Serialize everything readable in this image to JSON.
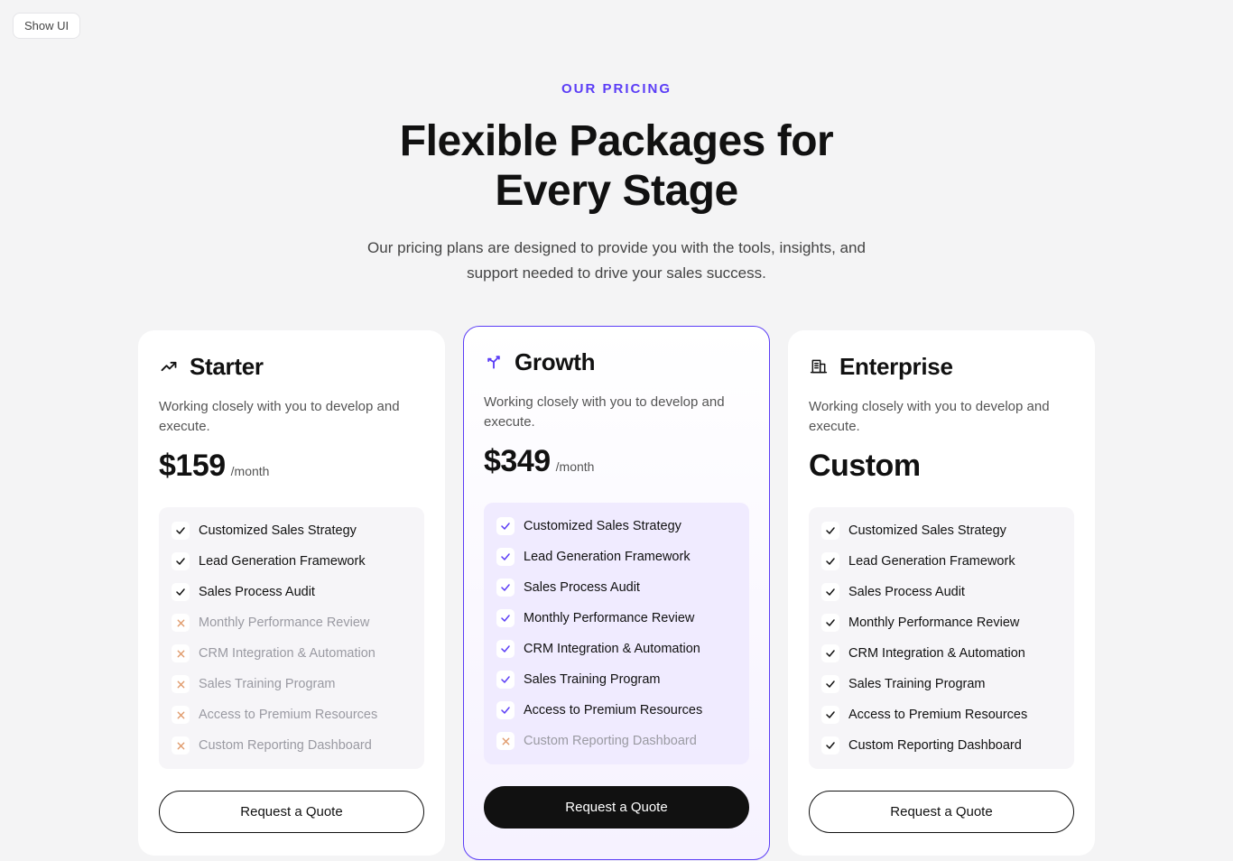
{
  "show_ui_label": "Show UI",
  "eyebrow": "OUR PRICING",
  "headline_line1": "Flexible Packages for",
  "headline_line2": "Every Stage",
  "subhead": "Our pricing plans are designed to provide you with the tools, insights, and support needed to drive your sales success.",
  "feature_names": [
    "Customized Sales Strategy",
    "Lead Generation Framework",
    "Sales Process Audit",
    "Monthly Performance Review",
    "CRM Integration & Automation",
    "Sales Training Program",
    "Access to Premium Resources",
    "Custom Reporting Dashboard"
  ],
  "plans": [
    {
      "name": "Starter",
      "icon": "trend",
      "desc": "Working closely with you to develop and execute.",
      "price": "$159",
      "period": "/month",
      "cta": "Request a Quote",
      "featured": false,
      "included": [
        true,
        true,
        true,
        false,
        false,
        false,
        false,
        false
      ]
    },
    {
      "name": "Growth",
      "icon": "branch",
      "desc": "Working closely with you to develop and execute.",
      "price": "$349",
      "period": "/month",
      "cta": "Request a Quote",
      "featured": true,
      "included": [
        true,
        true,
        true,
        true,
        true,
        true,
        true,
        false
      ]
    },
    {
      "name": "Enterprise",
      "icon": "building",
      "desc": "Working closely with you to develop and execute.",
      "price": "Custom",
      "period": "",
      "cta": "Request a Quote",
      "featured": false,
      "included": [
        true,
        true,
        true,
        true,
        true,
        true,
        true,
        true
      ]
    }
  ],
  "colors": {
    "accent": "#5B3DF6",
    "excluded": "#E09A6B"
  }
}
